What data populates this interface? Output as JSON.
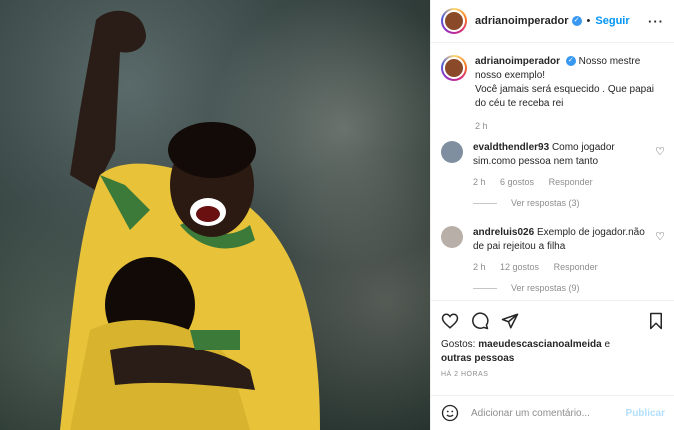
{
  "post": {
    "username": "adrianoimperador",
    "follow_label": "Seguir",
    "dot": "•",
    "more": "···"
  },
  "caption": {
    "username": "adrianoimperador",
    "line1": "Nosso mestre nosso exemplo!",
    "line2": "Você jamais será esquecido . Que papai do céu te receba rei",
    "time": "2 h"
  },
  "comments": [
    {
      "username": "evaldthendler93",
      "text": "Como jogador sim.como pessoa nem tanto",
      "time": "2 h",
      "likes": "6 gostos",
      "reply": "Responder",
      "view_replies": "Ver respostas (3)"
    },
    {
      "username": "andreluis026",
      "text": "Exemplo de jogador.não de pai rejeitou a filha",
      "time": "2 h",
      "likes": "12 gostos",
      "reply": "Responder",
      "view_replies": "Ver respostas (9)"
    }
  ],
  "likes": {
    "prefix": "Gostos:",
    "user": "maeudescascianoalmeida",
    "suffix": "e",
    "others": "outras pessoas"
  },
  "ago": "HÁ 2 HORAS",
  "add_comment": {
    "placeholder": "Adicionar um comentário...",
    "post_label": "Publicar"
  }
}
